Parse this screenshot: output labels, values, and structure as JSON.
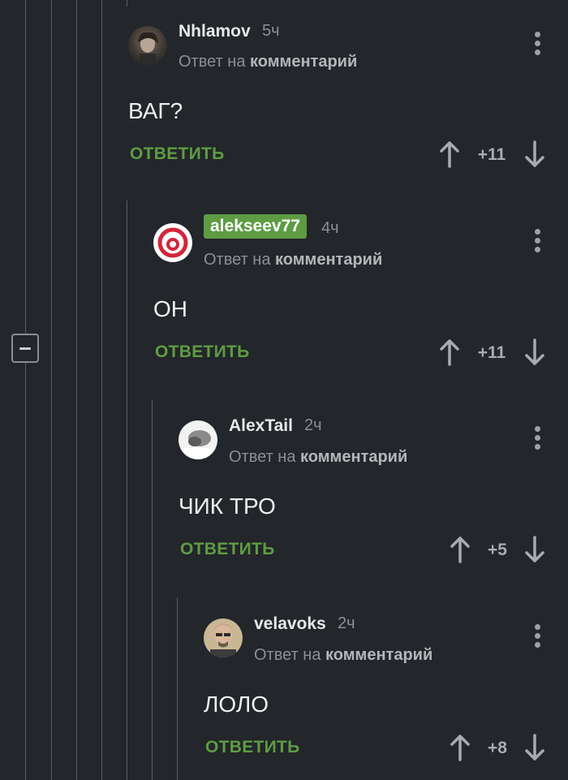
{
  "comments": [
    {
      "author": "Nhlamov",
      "time": "5ч",
      "reply_prefix": "Ответ на",
      "reply_link": "комментарий",
      "text": "ВАГ?",
      "reply_label": "ОТВЕТИТЬ",
      "rating": "+11",
      "author_badge": false
    },
    {
      "author": "alekseev77",
      "time": "4ч",
      "reply_prefix": "Ответ на",
      "reply_link": "комментарий",
      "text": "ОН",
      "reply_label": "ОТВЕТИТЬ",
      "rating": "+11",
      "author_badge": true,
      "badge_color": "#5e9c43"
    },
    {
      "author": "AlexTail",
      "time": "2ч",
      "reply_prefix": "Ответ на",
      "reply_link": "комментарий",
      "text": "ЧИК ТРО",
      "reply_label": "ОТВЕТИТЬ",
      "rating": "+5",
      "author_badge": false
    },
    {
      "author": "velavoks",
      "time": "2ч",
      "reply_prefix": "Ответ на",
      "reply_link": "комментарий",
      "text": "ЛОЛО",
      "reply_label": "ОТВЕТИТЬ",
      "rating": "+8",
      "author_badge": false
    }
  ],
  "colors": {
    "background": "#23262a",
    "accent": "#5e9c43",
    "muted": "#8c8f94",
    "thread_line": "#5a5d62"
  },
  "icons": {
    "collapse": "minus-square-icon",
    "menu": "kebab-menu-icon",
    "upvote": "arrow-up-icon",
    "downvote": "arrow-down-icon"
  }
}
